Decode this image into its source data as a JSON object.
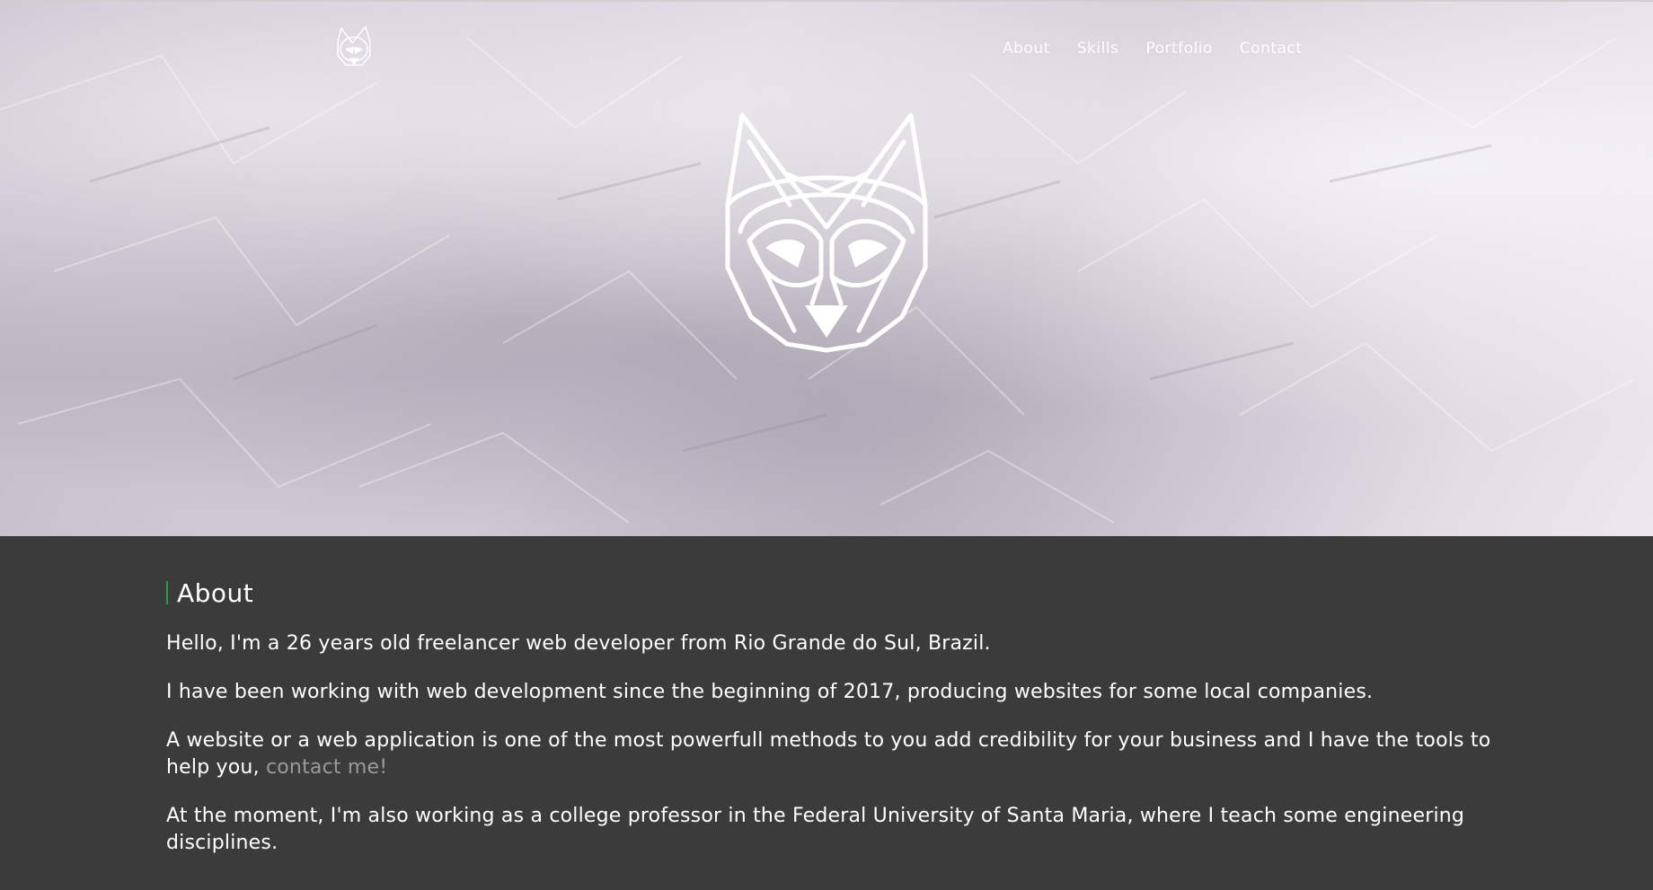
{
  "nav": {
    "items": [
      {
        "label": "About"
      },
      {
        "label": "Skills"
      },
      {
        "label": "Portfolio"
      },
      {
        "label": "Contact"
      }
    ]
  },
  "icons": {
    "nav_logo": "wolf-head-icon",
    "hero_logo": "wolf-head-icon"
  },
  "about": {
    "heading": "About",
    "p1": "Hello, I'm a 26 years old freelancer web developer from Rio Grande do Sul, Brazil.",
    "p2": "I have been working with web development since the beginning of 2017, producing websites for some local companies.",
    "p3_text": "A website or a web application is one of the most powerfull methods to you add credibility for your business and I have the tools to help you, ",
    "p3_link": "contact me!",
    "p4": "At the moment, I'm also working as a college professor in the Federal University of Santa Maria, where I teach some engineering disciplines."
  },
  "colors": {
    "section_bg": "#3b3b3b",
    "accent_bar": "#2e9e3f",
    "link": "#9a9a9a",
    "text": "#ffffff"
  }
}
